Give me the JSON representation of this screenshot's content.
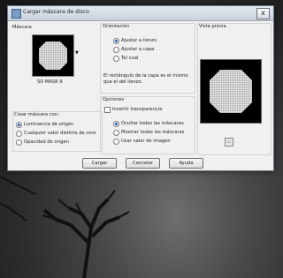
{
  "window": {
    "title": "Cargar máscara de disco",
    "close_label": "x"
  },
  "mask": {
    "section_label": "Máscara",
    "name": "SD MASK 9"
  },
  "crear": {
    "section_label": "Crear máscara con:",
    "options": [
      {
        "label": "Luminancia de origen",
        "selected": true
      },
      {
        "label": "Cualquier valor distinto de cero",
        "selected": false
      },
      {
        "label": "Opacidad de origen",
        "selected": false
      }
    ]
  },
  "orientacion": {
    "section_label": "Orientación",
    "options": [
      {
        "label": "Ajustar a lienzo",
        "selected": true
      },
      {
        "label": "Ajustar a capa",
        "selected": false
      },
      {
        "label": "Tal cual",
        "selected": false
      }
    ],
    "note": "El rectángulo de la capa es el mismo que el del lienzo."
  },
  "opciones": {
    "section_label": "Opciones",
    "invert_label": "Invertir transparencia",
    "invert_checked": false,
    "options": [
      {
        "label": "Ocultar todas las máscaras",
        "selected": true
      },
      {
        "label": "Mostrar todas las máscaras",
        "selected": false
      },
      {
        "label": "Usar valor de imagen",
        "selected": false
      }
    ]
  },
  "vista_previa": {
    "section_label": "Vista previa"
  },
  "buttons": {
    "cargar": "Cargar",
    "cancelar": "Cancelar",
    "ayuda": "Ayuda"
  },
  "colors": {
    "dialog_bg": "#f0f0f0",
    "selection_blue": "#1f5fb1"
  },
  "icons": {
    "preview_toggle": "preview-toggle-icon",
    "dropdown": "chevron-down-icon"
  }
}
